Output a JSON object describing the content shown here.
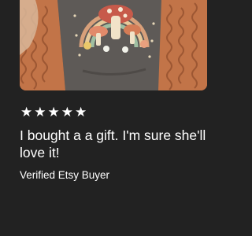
{
  "review": {
    "rating": 5,
    "rating_max": 5,
    "stars": [
      "★",
      "★",
      "★",
      "★",
      "★"
    ],
    "text": "I bought a a gift. I'm sure she'll love it!",
    "reviewer": "Verified Etsy Buyer"
  },
  "photo": {
    "icon": "product-photo-graphic-tee"
  },
  "colors": {
    "background": "#222222",
    "text": "#ffffff",
    "cardigan": "#b5673d",
    "shirt": "#5e5a57"
  }
}
